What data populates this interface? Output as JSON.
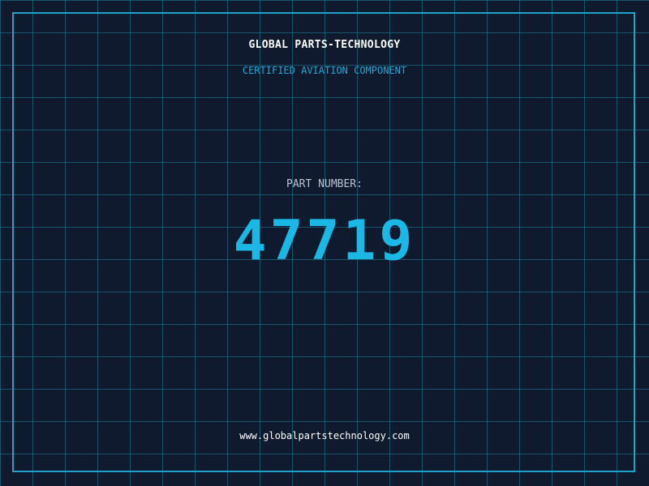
{
  "company_name": "GLOBAL PARTS-TECHNOLOGY",
  "tagline": "CERTIFIED AVIATION COMPONENT",
  "part_label": "PART NUMBER:",
  "part_number": "47719",
  "website": "www.globalpartstechnology.com",
  "colors": {
    "background": "#101a2e",
    "grid": "#22849e",
    "frame": "#1fa3cc",
    "accent": "#1ab8e4",
    "title": "#ffffff",
    "label": "#b8c4d2"
  }
}
